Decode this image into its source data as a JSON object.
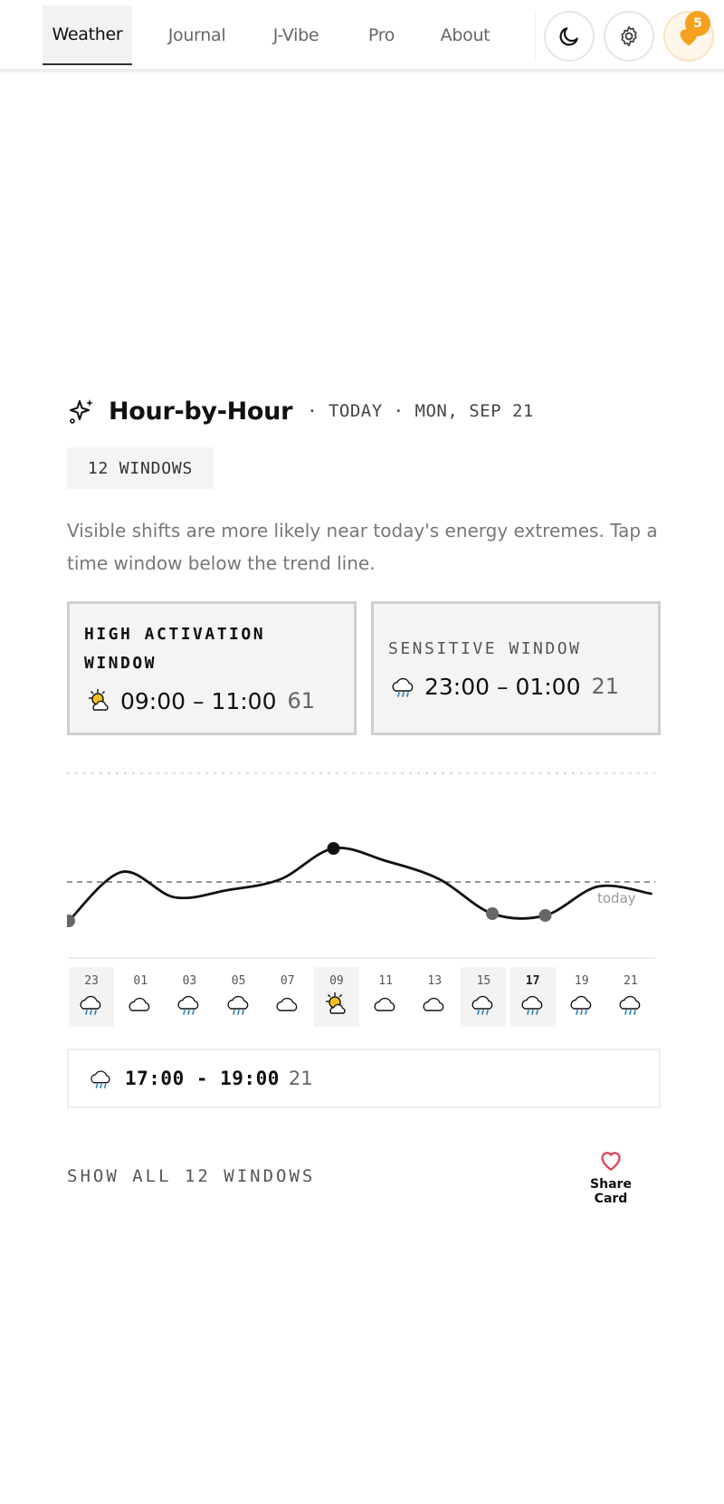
{
  "nav": {
    "tabs": [
      {
        "label": "Weather",
        "active": true
      },
      {
        "label": "Journal",
        "active": false
      },
      {
        "label": "J-Vibe",
        "active": false
      },
      {
        "label": "Pro",
        "active": false
      },
      {
        "label": "About",
        "active": false
      }
    ],
    "icons": [
      "moon-icon",
      "gear-icon",
      "heart-icon"
    ],
    "heart_badge": "5"
  },
  "header": {
    "title": "Hour-by-Hour",
    "meta": "· TODAY · MON, SEP 21",
    "chip": "12 WINDOWS",
    "description": "Visible shifts are more likely near today's energy extremes. Tap a time window below the trend line."
  },
  "cards": {
    "high": {
      "label_line1": "HIGH ACTIVATION",
      "label_line2": "WINDOW",
      "time": "09:00 – 11:00",
      "value": "61",
      "icon": "sun-cloud-icon"
    },
    "sensitive": {
      "label": "SENSITIVE WINDOW",
      "time": "23:00 – 01:00",
      "value": "21",
      "icon": "rain-cloud-icon"
    }
  },
  "chart_data": {
    "type": "line",
    "x": [
      "23",
      "01",
      "03",
      "05",
      "07",
      "09",
      "11",
      "13",
      "15",
      "17",
      "19",
      "21"
    ],
    "values": [
      21,
      48,
      34,
      38,
      44,
      61,
      54,
      44,
      25,
      24,
      40,
      36
    ],
    "reference_line_label": "today",
    "highlight_min": [
      0,
      8,
      9
    ],
    "highlight_max": [
      5
    ]
  },
  "hours": [
    {
      "label": "23",
      "icon": "rain-cloud-icon"
    },
    {
      "label": "01",
      "icon": "cloud-icon"
    },
    {
      "label": "03",
      "icon": "rain-cloud-icon"
    },
    {
      "label": "05",
      "icon": "rain-cloud-icon"
    },
    {
      "label": "07",
      "icon": "cloud-icon"
    },
    {
      "label": "09",
      "icon": "sun-cloud-icon"
    },
    {
      "label": "11",
      "icon": "cloud-icon"
    },
    {
      "label": "13",
      "icon": "cloud-icon"
    },
    {
      "label": "15",
      "icon": "rain-cloud-icon"
    },
    {
      "label": "17",
      "icon": "rain-cloud-icon"
    },
    {
      "label": "19",
      "icon": "rain-cloud-icon"
    },
    {
      "label": "21",
      "icon": "rain-cloud-icon"
    }
  ],
  "detail": {
    "time": "17:00 - 19:00",
    "value": "21",
    "icon": "rain-cloud-icon"
  },
  "footer": {
    "show_all": "SHOW ALL 12 WINDOWS",
    "share_line1": "Share",
    "share_line2": "Card"
  }
}
